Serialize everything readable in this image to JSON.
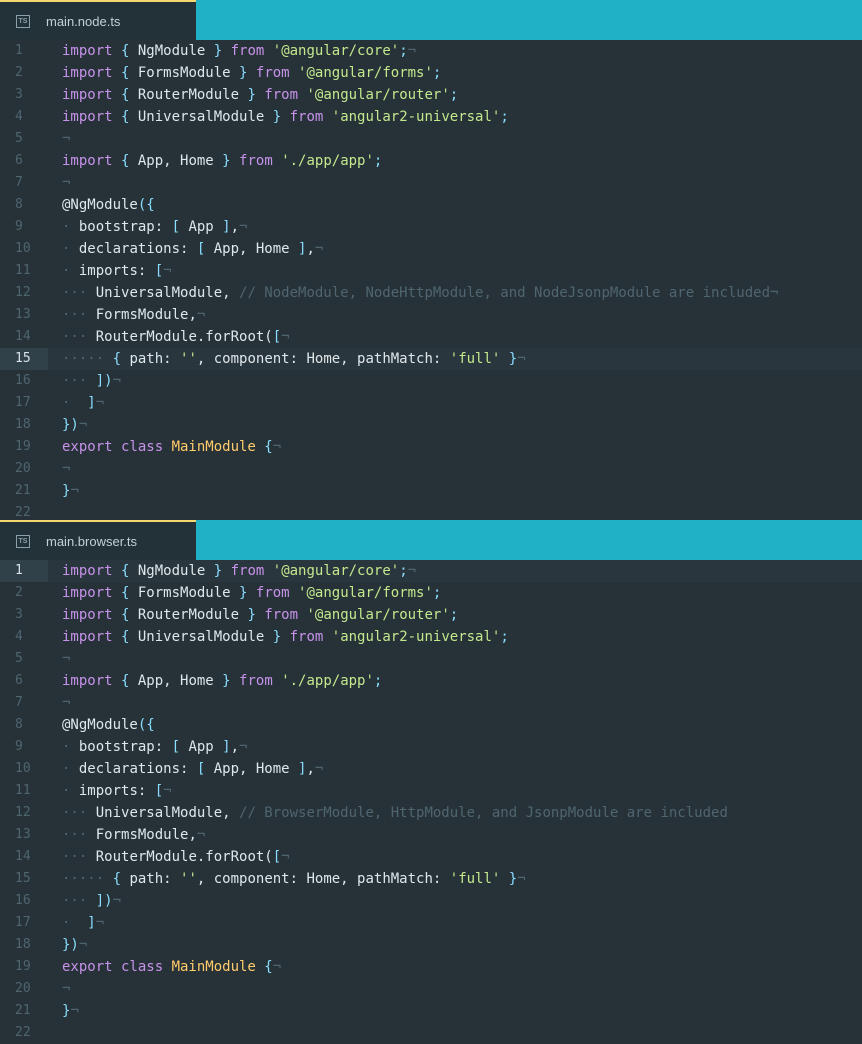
{
  "colors": {
    "tab_bar": "#21b1c6",
    "editor_bg": "#263238",
    "keyword": "#c792ea",
    "string": "#c3e88d",
    "class_name": "#ffcb6b",
    "comment": "#4f6570",
    "punctuation": "#89ddff"
  },
  "panes": [
    {
      "tab": {
        "icon": "typescript-file-icon",
        "icon_text": "TS",
        "label": "main.node.ts"
      },
      "active_line": 15,
      "lines": [
        {
          "n": "1",
          "t": [
            [
              "kw",
              "import"
            ],
            [
              "pn",
              " { "
            ],
            [
              "id",
              "NgModule"
            ],
            [
              "pn",
              " } "
            ],
            [
              "kw",
              "from"
            ],
            [
              "id",
              " "
            ],
            [
              "str",
              "'@angular/core'"
            ],
            [
              "pn",
              ";"
            ],
            [
              "cm",
              "¬"
            ]
          ]
        },
        {
          "n": "2",
          "t": [
            [
              "kw",
              "import"
            ],
            [
              "pn",
              " { "
            ],
            [
              "id",
              "FormsModule"
            ],
            [
              "pn",
              " } "
            ],
            [
              "kw",
              "from"
            ],
            [
              "id",
              " "
            ],
            [
              "str",
              "'@angular/forms'"
            ],
            [
              "pn",
              ";"
            ]
          ]
        },
        {
          "n": "3",
          "t": [
            [
              "kw",
              "import"
            ],
            [
              "pn",
              " { "
            ],
            [
              "id",
              "RouterModule"
            ],
            [
              "pn",
              " } "
            ],
            [
              "kw",
              "from"
            ],
            [
              "id",
              " "
            ],
            [
              "str",
              "'@angular/router'"
            ],
            [
              "pn",
              ";"
            ]
          ]
        },
        {
          "n": "4",
          "t": [
            [
              "kw",
              "import"
            ],
            [
              "pn",
              " { "
            ],
            [
              "id",
              "UniversalModule"
            ],
            [
              "pn",
              " } "
            ],
            [
              "kw",
              "from"
            ],
            [
              "id",
              " "
            ],
            [
              "str",
              "'angular2-universal'"
            ],
            [
              "pn",
              ";"
            ]
          ]
        },
        {
          "n": "5",
          "t": [
            [
              "cm",
              "¬"
            ]
          ]
        },
        {
          "n": "6",
          "t": [
            [
              "kw",
              "import"
            ],
            [
              "pn",
              " { "
            ],
            [
              "id",
              "App, Home"
            ],
            [
              "pn",
              " } "
            ],
            [
              "kw",
              "from"
            ],
            [
              "id",
              " "
            ],
            [
              "str",
              "'./app/app'"
            ],
            [
              "pn",
              ";"
            ]
          ]
        },
        {
          "n": "7",
          "t": [
            [
              "cm",
              "¬"
            ]
          ]
        },
        {
          "n": "8",
          "t": [
            [
              "id",
              "@NgModule"
            ],
            [
              "pn",
              "({"
            ]
          ]
        },
        {
          "n": "9",
          "t": [
            [
              "cm",
              "·"
            ],
            [
              "id",
              " bootstrap: "
            ],
            [
              "pn",
              "[ "
            ],
            [
              "id",
              "App"
            ],
            [
              "pn",
              " ]"
            ],
            [
              "id",
              ","
            ],
            [
              "cm",
              "¬"
            ]
          ]
        },
        {
          "n": "10",
          "t": [
            [
              "cm",
              "·"
            ],
            [
              "id",
              " declarations: "
            ],
            [
              "pn",
              "[ "
            ],
            [
              "id",
              "App, Home"
            ],
            [
              "pn",
              " ]"
            ],
            [
              "id",
              ","
            ],
            [
              "cm",
              "¬"
            ]
          ]
        },
        {
          "n": "11",
          "t": [
            [
              "cm",
              "·"
            ],
            [
              "id",
              " imports: "
            ],
            [
              "pn",
              "["
            ],
            [
              "cm",
              "¬"
            ]
          ]
        },
        {
          "n": "12",
          "t": [
            [
              "cm",
              "···"
            ],
            [
              "id",
              " UniversalModule, "
            ],
            [
              "cm",
              "// NodeModule, NodeHttpModule, and NodeJsonpModule are included¬"
            ]
          ]
        },
        {
          "n": "13",
          "t": [
            [
              "cm",
              "···"
            ],
            [
              "id",
              " FormsModule,"
            ],
            [
              "cm",
              "¬"
            ]
          ]
        },
        {
          "n": "14",
          "t": [
            [
              "cm",
              "···"
            ],
            [
              "id",
              " RouterModule.forRoot("
            ],
            [
              "pn",
              "["
            ],
            [
              "cm",
              "¬"
            ]
          ]
        },
        {
          "n": "15",
          "t": [
            [
              "cm",
              "·····"
            ],
            [
              "pn",
              " { "
            ],
            [
              "id",
              "path: "
            ],
            [
              "str",
              "''"
            ],
            [
              "id",
              ", component: Home, pathMatch: "
            ],
            [
              "str",
              "'full'"
            ],
            [
              "pn",
              " }"
            ],
            [
              "cm",
              "¬"
            ]
          ]
        },
        {
          "n": "16",
          "t": [
            [
              "cm",
              "···"
            ],
            [
              "pn",
              " ])"
            ],
            [
              "cm",
              "¬"
            ]
          ]
        },
        {
          "n": "17",
          "t": [
            [
              "cm",
              "·"
            ],
            [
              "pn",
              "  ]"
            ],
            [
              "cm",
              "¬"
            ]
          ]
        },
        {
          "n": "18",
          "t": [
            [
              "pn",
              "})"
            ],
            [
              "cm",
              "¬"
            ]
          ]
        },
        {
          "n": "19",
          "t": [
            [
              "kw",
              "export class "
            ],
            [
              "cls",
              "MainModule"
            ],
            [
              "pn",
              " {"
            ],
            [
              "cm",
              "¬"
            ]
          ]
        },
        {
          "n": "20",
          "t": [
            [
              "cm",
              "¬"
            ]
          ]
        },
        {
          "n": "21",
          "t": [
            [
              "pn",
              "}"
            ],
            [
              "cm",
              "¬"
            ]
          ]
        },
        {
          "n": "22",
          "t": []
        }
      ]
    },
    {
      "tab": {
        "icon": "typescript-file-icon",
        "icon_text": "TS",
        "label": "main.browser.ts"
      },
      "active_line": 1,
      "lines": [
        {
          "n": "1",
          "t": [
            [
              "kw",
              "import"
            ],
            [
              "pn",
              " { "
            ],
            [
              "id",
              "NgModule"
            ],
            [
              "pn",
              " } "
            ],
            [
              "kw",
              "from"
            ],
            [
              "id",
              " "
            ],
            [
              "str",
              "'@angular/core'"
            ],
            [
              "pn",
              ";"
            ],
            [
              "cm",
              "¬"
            ]
          ]
        },
        {
          "n": "2",
          "t": [
            [
              "kw",
              "import"
            ],
            [
              "pn",
              " { "
            ],
            [
              "id",
              "FormsModule"
            ],
            [
              "pn",
              " } "
            ],
            [
              "kw",
              "from"
            ],
            [
              "id",
              " "
            ],
            [
              "str",
              "'@angular/forms'"
            ],
            [
              "pn",
              ";"
            ]
          ]
        },
        {
          "n": "3",
          "t": [
            [
              "kw",
              "import"
            ],
            [
              "pn",
              " { "
            ],
            [
              "id",
              "RouterModule"
            ],
            [
              "pn",
              " } "
            ],
            [
              "kw",
              "from"
            ],
            [
              "id",
              " "
            ],
            [
              "str",
              "'@angular/router'"
            ],
            [
              "pn",
              ";"
            ]
          ]
        },
        {
          "n": "4",
          "t": [
            [
              "kw",
              "import"
            ],
            [
              "pn",
              " { "
            ],
            [
              "id",
              "UniversalModule"
            ],
            [
              "pn",
              " } "
            ],
            [
              "kw",
              "from"
            ],
            [
              "id",
              " "
            ],
            [
              "str",
              "'angular2-universal'"
            ],
            [
              "pn",
              ";"
            ]
          ]
        },
        {
          "n": "5",
          "t": [
            [
              "cm",
              "¬"
            ]
          ]
        },
        {
          "n": "6",
          "t": [
            [
              "kw",
              "import"
            ],
            [
              "pn",
              " { "
            ],
            [
              "id",
              "App, Home"
            ],
            [
              "pn",
              " } "
            ],
            [
              "kw",
              "from"
            ],
            [
              "id",
              " "
            ],
            [
              "str",
              "'./app/app'"
            ],
            [
              "pn",
              ";"
            ]
          ]
        },
        {
          "n": "7",
          "t": [
            [
              "cm",
              "¬"
            ]
          ]
        },
        {
          "n": "8",
          "t": [
            [
              "id",
              "@NgModule"
            ],
            [
              "pn",
              "({"
            ]
          ]
        },
        {
          "n": "9",
          "t": [
            [
              "cm",
              "·"
            ],
            [
              "id",
              " bootstrap: "
            ],
            [
              "pn",
              "[ "
            ],
            [
              "id",
              "App"
            ],
            [
              "pn",
              " ]"
            ],
            [
              "id",
              ","
            ],
            [
              "cm",
              "¬"
            ]
          ]
        },
        {
          "n": "10",
          "t": [
            [
              "cm",
              "·"
            ],
            [
              "id",
              " declarations: "
            ],
            [
              "pn",
              "[ "
            ],
            [
              "id",
              "App, Home"
            ],
            [
              "pn",
              " ]"
            ],
            [
              "id",
              ","
            ],
            [
              "cm",
              "¬"
            ]
          ]
        },
        {
          "n": "11",
          "t": [
            [
              "cm",
              "·"
            ],
            [
              "id",
              " imports: "
            ],
            [
              "pn",
              "["
            ],
            [
              "cm",
              "¬"
            ]
          ]
        },
        {
          "n": "12",
          "t": [
            [
              "cm",
              "···"
            ],
            [
              "id",
              " UniversalModule, "
            ],
            [
              "cm",
              "// BrowserModule, HttpModule, and JsonpModule are included"
            ]
          ]
        },
        {
          "n": "13",
          "t": [
            [
              "cm",
              "···"
            ],
            [
              "id",
              " FormsModule,"
            ],
            [
              "cm",
              "¬"
            ]
          ]
        },
        {
          "n": "14",
          "t": [
            [
              "cm",
              "···"
            ],
            [
              "id",
              " RouterModule.forRoot("
            ],
            [
              "pn",
              "["
            ],
            [
              "cm",
              "¬"
            ]
          ]
        },
        {
          "n": "15",
          "t": [
            [
              "cm",
              "·····"
            ],
            [
              "pn",
              " { "
            ],
            [
              "id",
              "path: "
            ],
            [
              "str",
              "''"
            ],
            [
              "id",
              ", component: Home, pathMatch: "
            ],
            [
              "str",
              "'full'"
            ],
            [
              "pn",
              " }"
            ],
            [
              "cm",
              "¬"
            ]
          ]
        },
        {
          "n": "16",
          "t": [
            [
              "cm",
              "···"
            ],
            [
              "pn",
              " ])"
            ],
            [
              "cm",
              "¬"
            ]
          ]
        },
        {
          "n": "17",
          "t": [
            [
              "cm",
              "·"
            ],
            [
              "pn",
              "  ]"
            ],
            [
              "cm",
              "¬"
            ]
          ]
        },
        {
          "n": "18",
          "t": [
            [
              "pn",
              "})"
            ],
            [
              "cm",
              "¬"
            ]
          ]
        },
        {
          "n": "19",
          "t": [
            [
              "kw",
              "export class "
            ],
            [
              "cls",
              "MainModule"
            ],
            [
              "pn",
              " {"
            ],
            [
              "cm",
              "¬"
            ]
          ]
        },
        {
          "n": "20",
          "t": [
            [
              "cm",
              "¬"
            ]
          ]
        },
        {
          "n": "21",
          "t": [
            [
              "pn",
              "}"
            ],
            [
              "cm",
              "¬"
            ]
          ]
        },
        {
          "n": "22",
          "t": []
        }
      ]
    }
  ]
}
